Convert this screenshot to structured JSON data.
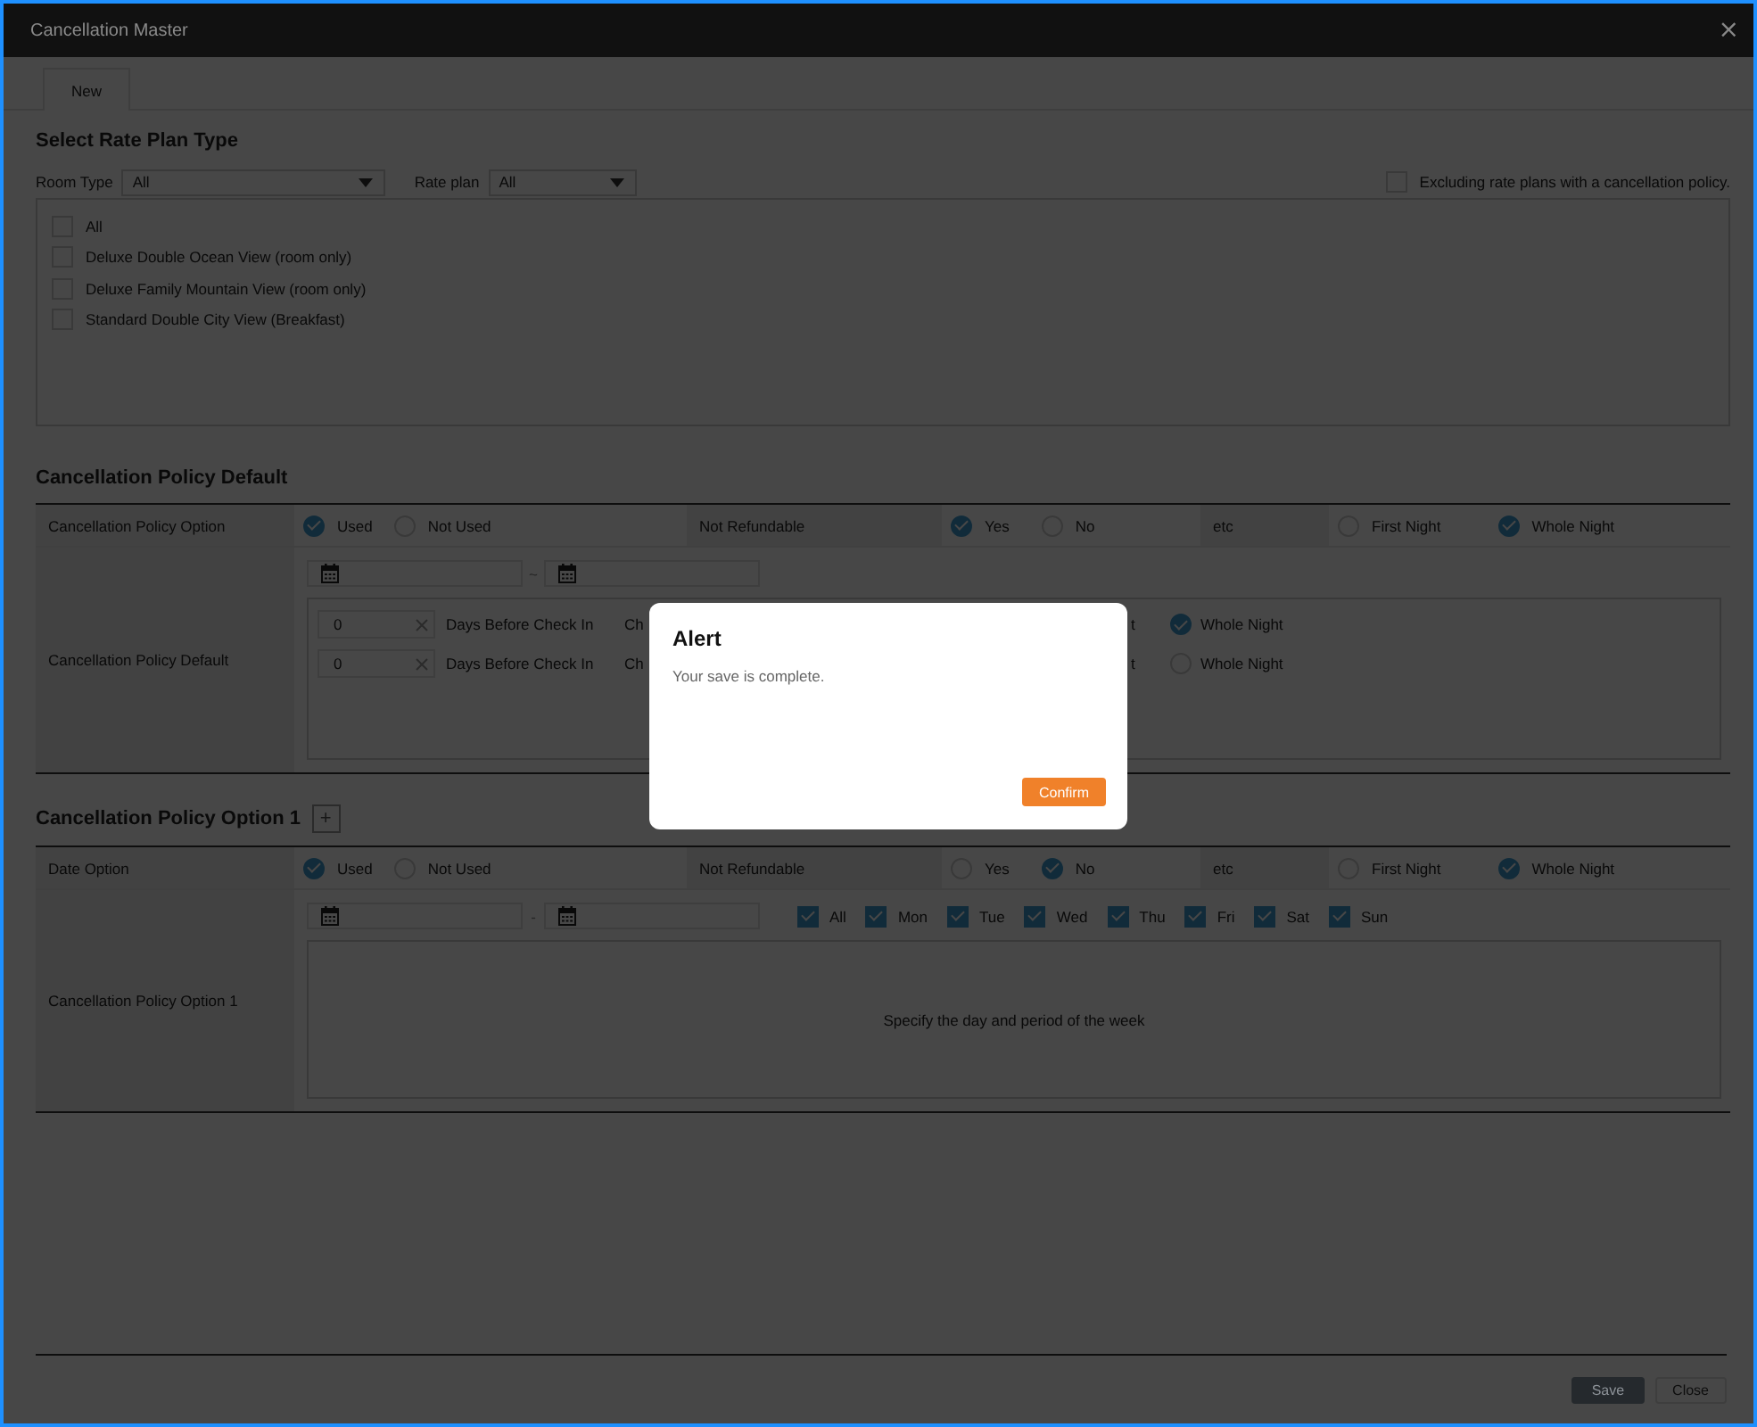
{
  "window": {
    "title": "Cancellation Master",
    "close_button": "×"
  },
  "tabs": [
    {
      "label": "New",
      "selected": true
    }
  ],
  "rate_plan_type": {
    "heading": "Select Rate Plan Type",
    "filters": [
      {
        "label": "Room Type",
        "value": "All"
      },
      {
        "label": "Rate plan",
        "value": "All"
      }
    ],
    "exclude_option": {
      "label": "Excluding rate plans with a cancellation policy.",
      "checked": false
    },
    "rate_plans": [
      {
        "label": "All",
        "checked": false
      },
      {
        "label": "Deluxe Double Ocean View (room only)",
        "checked": false
      },
      {
        "label": "Deluxe Family Mountain View (room only)",
        "checked": false
      },
      {
        "label": "Standard Double City View (Breakfast)",
        "checked": false
      }
    ]
  },
  "policy_default": {
    "heading": "Cancellation Policy Default",
    "option_row": {
      "label": "Cancellation Policy Option",
      "usage": [
        {
          "label": "Used",
          "selected": true
        },
        {
          "label": "Not Used",
          "selected": false
        }
      ],
      "refund_label": "Not Refundable",
      "refund": [
        {
          "label": "Yes",
          "selected": true
        },
        {
          "label": "No",
          "selected": false
        }
      ],
      "etc_label": "etc",
      "nights": [
        {
          "label": "First Night",
          "selected": false
        },
        {
          "label": "Whole Night",
          "selected": true
        }
      ]
    },
    "detail_label": "Cancellation Policy Default",
    "range_separator": "~",
    "rules": [
      {
        "days": "0",
        "unit": "Days Before Check In",
        "cut_text": "Ch",
        "cut_text_2": "t",
        "night": {
          "label": "Whole Night",
          "selected": true
        }
      },
      {
        "days": "0",
        "unit": "Days Before Check In",
        "cut_text": "Ch",
        "cut_text_2": "t",
        "night": {
          "label": "Whole Night",
          "selected": false
        }
      }
    ]
  },
  "policy_option_1": {
    "heading": "Cancellation Policy Option 1",
    "add_button": "+",
    "option_row": {
      "label": "Date Option",
      "usage": [
        {
          "label": "Used",
          "selected": true
        },
        {
          "label": "Not Used",
          "selected": false
        }
      ],
      "refund_label": "Not Refundable",
      "refund": [
        {
          "label": "Yes",
          "selected": false
        },
        {
          "label": "No",
          "selected": true
        }
      ],
      "etc_label": "etc",
      "nights": [
        {
          "label": "First Night",
          "selected": false
        },
        {
          "label": "Whole Night",
          "selected": true
        }
      ]
    },
    "detail_label": "Cancellation Policy Option 1",
    "range_separator": "-",
    "days": [
      {
        "label": "All",
        "checked": true
      },
      {
        "label": "Mon",
        "checked": true
      },
      {
        "label": "Tue",
        "checked": true
      },
      {
        "label": "Wed",
        "checked": true
      },
      {
        "label": "Thu",
        "checked": true
      },
      {
        "label": "Fri",
        "checked": true
      },
      {
        "label": "Sat",
        "checked": true
      },
      {
        "label": "Sun",
        "checked": true
      }
    ],
    "hint": "Specify the day and period of the week"
  },
  "footer_buttons": [
    {
      "label": "Save",
      "primary": true
    },
    {
      "label": "Close",
      "primary": false
    }
  ],
  "alert": {
    "title": "Alert",
    "message": "Your save is complete.",
    "button": "Confirm"
  }
}
